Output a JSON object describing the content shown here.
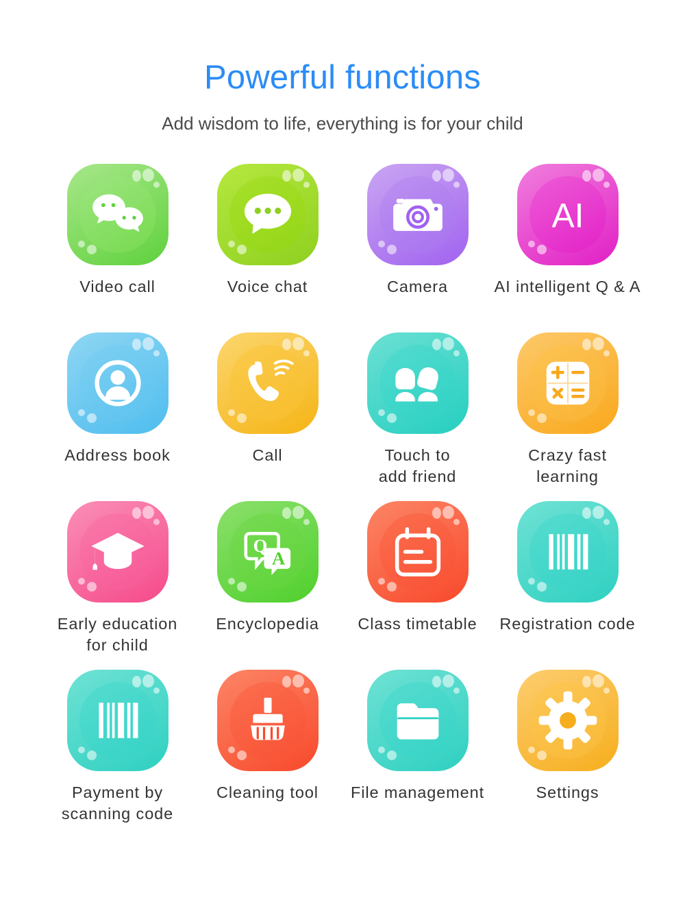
{
  "header": {
    "title": "Powerful functions",
    "subtitle": "Add wisdom to life, everything is for your child",
    "title_color": "#2b8cf5",
    "subtitle_color": "#4a4a4a"
  },
  "features": [
    {
      "label": "Video call",
      "icon": "chat-bubbles-icon",
      "outer_from": "#a8e78a",
      "outer_to": "#5fd13c",
      "disc_from": "#9ee581",
      "disc_to": "#76da4e"
    },
    {
      "label": "Voice chat",
      "icon": "speech-bubble-dots-icon",
      "outer_from": "#b6e83f",
      "outer_to": "#8ed020",
      "disc_from": "#a7e02a",
      "disc_to": "#94d618"
    },
    {
      "label": "Camera",
      "icon": "camera-icon",
      "outer_from": "#c9a6f2",
      "outer_to": "#a162ef",
      "disc_from": "#bb92f0",
      "disc_to": "#a871f0"
    },
    {
      "label": "AI intelligent Q & A",
      "icon": "ai-text-icon",
      "outer_from": "#f07fdd",
      "outer_to": "#e11fc5",
      "disc_from": "#ed5bd6",
      "disc_to": "#e322c8"
    },
    {
      "label": "Address book",
      "icon": "contact-person-icon",
      "outer_from": "#8fd6f3",
      "outer_to": "#4ebdee",
      "disc_from": "#7ecff2",
      "disc_to": "#5cc3ef"
    },
    {
      "label": "Call",
      "icon": "phone-call-icon",
      "outer_from": "#fcd66e",
      "outer_to": "#f5b415",
      "disc_from": "#fbcb4d",
      "disc_to": "#f7bd2b"
    },
    {
      "label": "Touch to\nadd friend",
      "icon": "two-people-icon",
      "outer_from": "#6ce0d3",
      "outer_to": "#25cfc0",
      "disc_from": "#53dbcf",
      "disc_to": "#2fd2c4"
    },
    {
      "label": "Crazy fast\nlearning",
      "icon": "calculator-icon",
      "outer_from": "#fdc96a",
      "outer_to": "#f9a81c",
      "disc_from": "#fcc352",
      "disc_to": "#fab334"
    },
    {
      "label": "Early education\nfor child",
      "icon": "graduation-cap-icon",
      "outer_from": "#fa8fb6",
      "outer_to": "#f54a8b",
      "disc_from": "#f97aa9",
      "disc_to": "#f75796"
    },
    {
      "label": "Encyclopedia",
      "icon": "qa-bubbles-icon",
      "outer_from": "#8ce06c",
      "outer_to": "#4fd02c",
      "disc_from": "#79da55",
      "disc_to": "#5ed438"
    },
    {
      "label": "Class timetable",
      "icon": "calendar-icon",
      "outer_from": "#fc8566",
      "outer_to": "#f8492b",
      "disc_from": "#fb6f4f",
      "disc_to": "#f95134"
    },
    {
      "label": "Registration code",
      "icon": "barcode-icon",
      "outer_from": "#6fe2d4",
      "outer_to": "#2ed0c1",
      "disc_from": "#56dccf",
      "disc_to": "#35d3c6"
    },
    {
      "label": "Payment by\nscanning code",
      "icon": "barcode-icon",
      "outer_from": "#6fe2d4",
      "outer_to": "#2ed0c1",
      "disc_from": "#56dccf",
      "disc_to": "#35d3c6"
    },
    {
      "label": "Cleaning tool",
      "icon": "broom-icon",
      "outer_from": "#fc8566",
      "outer_to": "#f8492b",
      "disc_from": "#fb6f4f",
      "disc_to": "#f95134"
    },
    {
      "label": "File management",
      "icon": "folder-icon",
      "outer_from": "#6fe2d4",
      "outer_to": "#2ed0c1",
      "disc_from": "#56dccf",
      "disc_to": "#35d3c6"
    },
    {
      "label": "Settings",
      "icon": "gear-icon",
      "outer_from": "#fdcd6f",
      "outer_to": "#f6ae1d",
      "disc_from": "#fcc757",
      "disc_to": "#f9b936"
    }
  ]
}
